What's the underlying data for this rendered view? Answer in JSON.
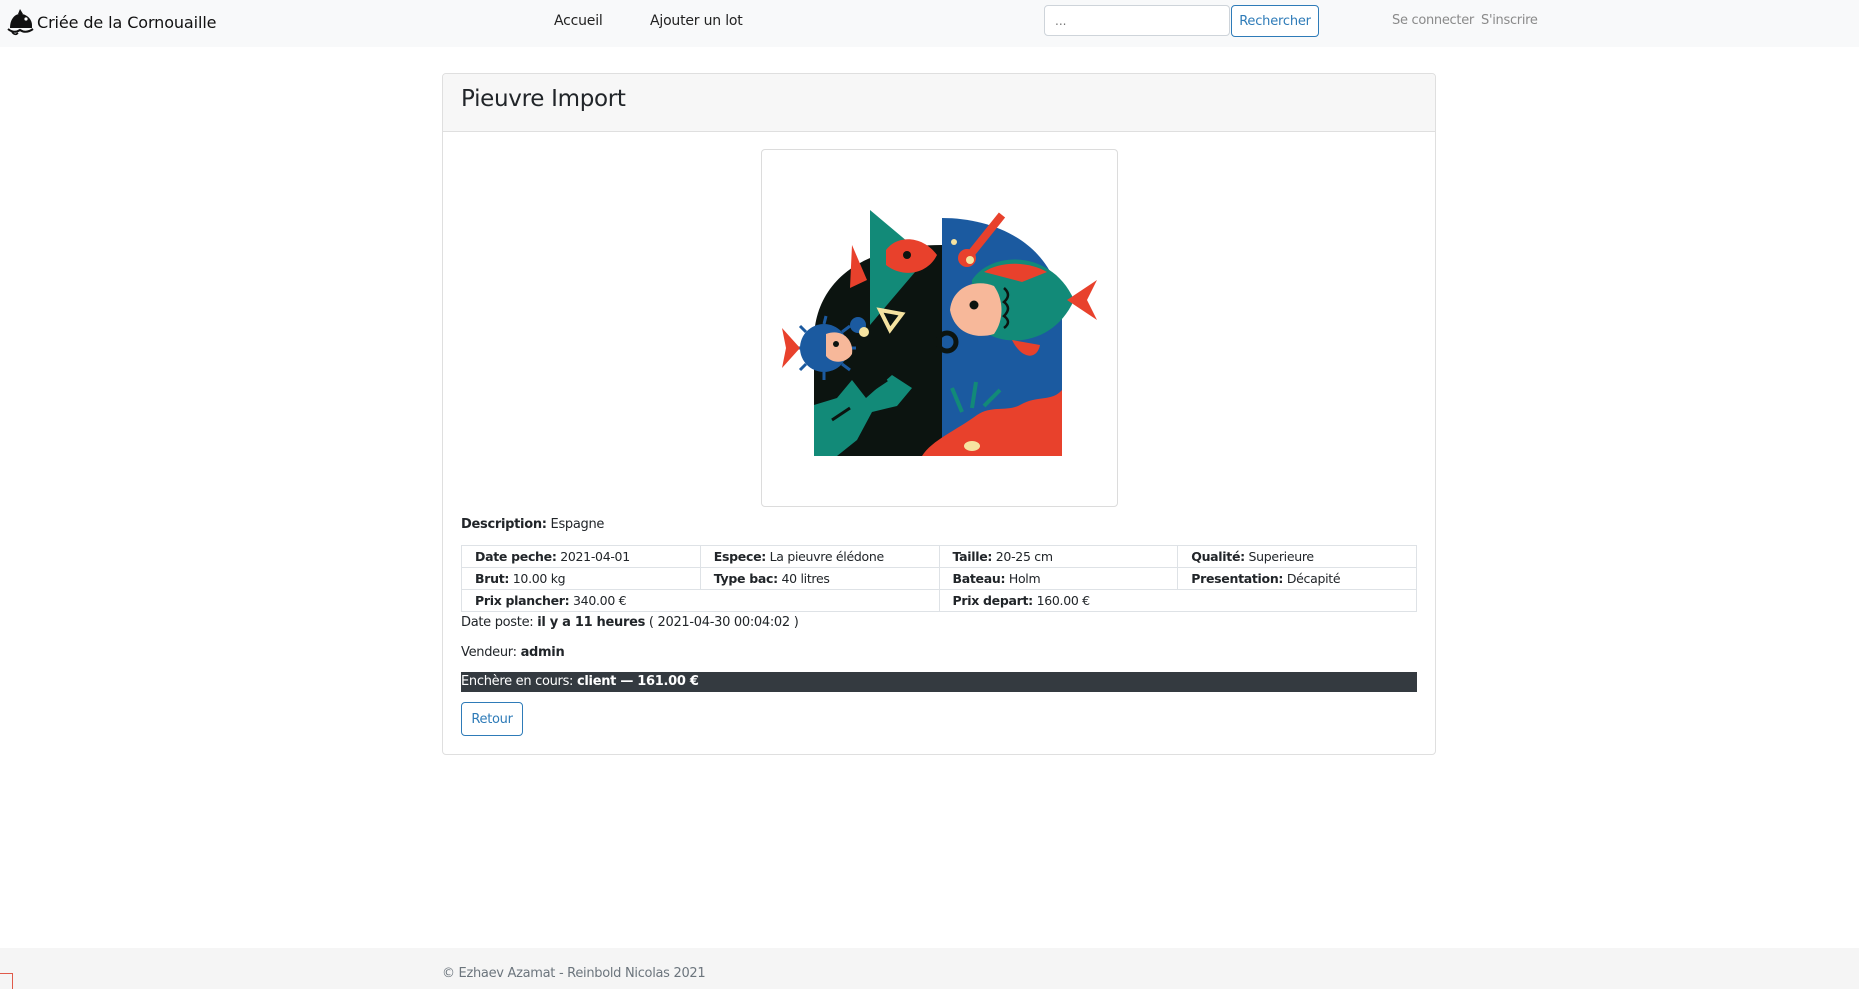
{
  "navbar": {
    "brand": "Criée de la Cornouaille",
    "brand_icon": "fish-boat-logo-icon",
    "links": {
      "home": "Accueil",
      "add_lot": "Ajouter un lot"
    },
    "search": {
      "placeholder": "...",
      "button": "Rechercher"
    },
    "auth": {
      "login": "Se connecter",
      "signup": "S'inscrire"
    }
  },
  "lot": {
    "title": "Pieuvre Import",
    "image_icon": "underwater-fish-illustration",
    "description": {
      "label": "Description:",
      "value": "Espagne"
    },
    "details": {
      "date_peche": {
        "label": "Date peche:",
        "value": "2021-04-01"
      },
      "espece": {
        "label": "Espece:",
        "value": "La pieuvre élédone"
      },
      "taille": {
        "label": "Taille:",
        "value": "20-25 cm"
      },
      "qualite": {
        "label": "Qualité:",
        "value": "Superieure"
      },
      "brut": {
        "label": "Brut:",
        "value": "10.00 kg"
      },
      "type_bac": {
        "label": "Type bac:",
        "value": "40 litres"
      },
      "bateau": {
        "label": "Bateau:",
        "value": "Holm"
      },
      "presentation": {
        "label": "Presentation:",
        "value": "Décapité"
      },
      "prix_plancher": {
        "label": "Prix plancher:",
        "value": "340.00 €"
      },
      "prix_depart": {
        "label": "Prix depart:",
        "value": "160.00 €"
      }
    },
    "date_poste": {
      "label": "Date poste:",
      "relative": "il y a 11 heures",
      "absolute": "( 2021-04-30 00:04:02 )"
    },
    "vendeur": {
      "label": "Vendeur:",
      "value": "admin"
    },
    "enchere": {
      "label": "Enchère en cours:",
      "value": "client — 161.00 €"
    },
    "back_button": "Retour"
  },
  "footer": {
    "text": "© Ezhaev Azamat - Reinbold Nicolas 2021"
  },
  "colors": {
    "navbar_bg": "#f8f9fa",
    "primary": "#2e7bb8",
    "bid_bar": "#343a40",
    "illustration_blue": "#1b5aa0",
    "illustration_teal": "#128a78",
    "illustration_red": "#e8412c"
  }
}
